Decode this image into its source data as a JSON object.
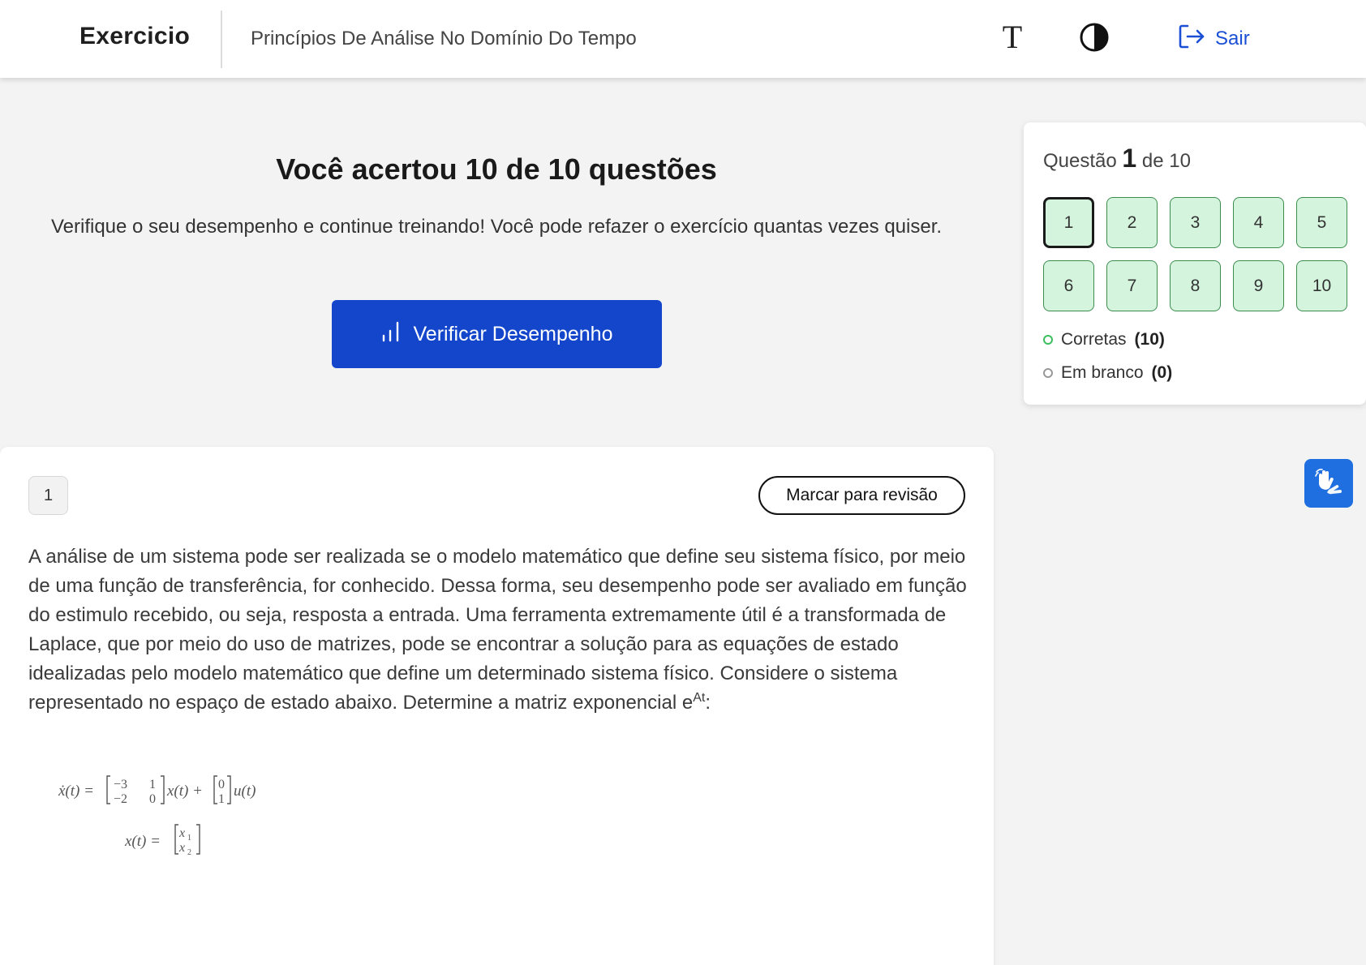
{
  "header": {
    "brand": "Exercicio",
    "course_title": "Princípios De Análise No Domínio Do Tempo",
    "font_icon_glyph": "T",
    "logout_label": "Sair",
    "accent_color": "#1a4fd6"
  },
  "result": {
    "title": "Você acertou 10 de 10 questões",
    "description": "Verifique o seu desempenho e continue treinando! Você pode refazer o exercício quantas vezes quiser.",
    "button_label": "Verificar Desempenho",
    "button_color": "#1446cc"
  },
  "panel": {
    "counter_prefix": "Questão",
    "current": "1",
    "counter_suffix": "de 10",
    "questions": [
      "1",
      "2",
      "3",
      "4",
      "5",
      "6",
      "7",
      "8",
      "9",
      "10"
    ],
    "legend_correct_label": "Corretas",
    "legend_correct_count": "(10)",
    "legend_blank_label": "Em branco",
    "legend_blank_count": "(0)"
  },
  "question": {
    "number": "1",
    "mark_review_label": "Marcar para revisão",
    "text": "A análise de um sistema pode ser realizada se o modelo matemático que define seu sistema físico, por meio de uma função de transferência, for conhecido. Dessa forma, seu desempenho pode ser avaliado em função do estimulo recebido, ou seja, resposta a entrada. Uma ferramenta extremamente útil é a transformada de Laplace, que por meio do uso de matrizes, pode se encontrar a solução para as equações de estado idealizadas pelo modelo matemático que define um determinado sistema físico. Considere o sistema representado no espaço de estado abaixo. Determine a matriz exponencial e",
    "text_sup": "At",
    "text_end": ":",
    "formula": {
      "lhs1": "ẋ(t) =",
      "matrixA": [
        [
          "−3",
          "1"
        ],
        [
          "−2",
          "0"
        ]
      ],
      "mid1": "x(t) +",
      "matrixB": [
        "0",
        "1"
      ],
      "rhs1": "u(t)",
      "lhs2": "x(t) =",
      "vectorX": [
        "x",
        "x"
      ],
      "vectorX_sub": [
        "1",
        "2"
      ]
    }
  },
  "icons": {
    "header": [
      "font-size-icon",
      "contrast-icon",
      "logout-icon"
    ],
    "button": "bar-chart-icon",
    "floating": "sign-language-icon"
  }
}
